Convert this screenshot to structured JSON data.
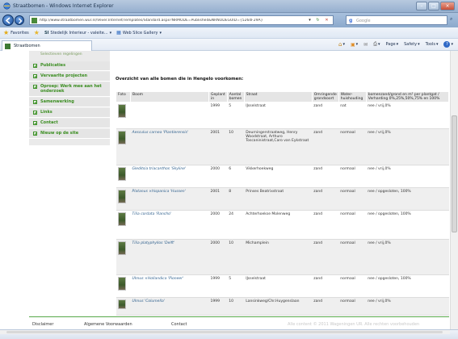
{
  "window": {
    "title": "Straatbomen - Windows Internet Explorer"
  },
  "address_bar": {
    "url": "http://www.straatbomen.wur.nl/Vever.Internet/Templates/Standard.aspx?NRMODE=Published&NRNODEGUID={5264F29A}",
    "search_placeholder": "Google"
  },
  "favorites_bar": {
    "favorites_label": "Favorites",
    "items": [
      {
        "label": "Stedelijk Interieur - valeite..."
      },
      {
        "label": "Web Slice Gallery"
      }
    ]
  },
  "tab": {
    "label": "Straatbomen"
  },
  "command_bar": {
    "items": [
      "Page",
      "Safety",
      "Tools"
    ]
  },
  "leftnav": {
    "cut_text": "Selectieven regelingen",
    "items": [
      {
        "label": "Publicaties"
      },
      {
        "label": "Vervaarlte projecten"
      },
      {
        "label": "Oproep: Werk mee aan het onderzoek"
      },
      {
        "label": "Samenwerking"
      },
      {
        "label": "Links"
      },
      {
        "label": "Contact"
      },
      {
        "label": "Nieuw op de site"
      }
    ]
  },
  "main": {
    "heading": "Overzicht van alle bomen die in Hengelo voorkomen:",
    "columns": [
      "Foto",
      "Boom",
      "Geplant in",
      "Aantal bomen",
      "Straat",
      "Omringende grondsoort",
      "Water-huishouding",
      "bomenzand/grond en m² per plantgat / Verharding 0%,25%,50%,75% en 100%"
    ],
    "rows": [
      {
        "boom": "",
        "geplant": "1999",
        "aantal": "5",
        "straat": "IJsselstraat",
        "grond": "zand",
        "water": "nat",
        "verharding": "nee / vrij,0%"
      },
      {
        "boom": "Aesculus carnea 'Plantierensis'",
        "geplant": "2001",
        "aantal": "10",
        "straat": "Deurningerstraatweg, Henry Woodstraat, Arthuro Toscaninistraat,Caro van Eykstraat",
        "grond": "zand",
        "water": "normaal",
        "verharding": "nee / vrij,0%"
      },
      {
        "boom": "Gleditsia triacanthos 'Skyline'",
        "geplant": "2000",
        "aantal": "6",
        "straat": "Vikkerhoekweg",
        "grond": "zand",
        "water": "normaal",
        "verharding": "nee / vrij,0%"
      },
      {
        "boom": "Platanus ×hispanica 'Hussen'",
        "geplant": "2001",
        "aantal": "8",
        "straat": "Prinses Beatrixstraat",
        "grond": "zand",
        "water": "normaal",
        "verharding": "nee / opgesloten, 100%"
      },
      {
        "boom": "Tilia cordata 'Rancho'",
        "geplant": "2000",
        "aantal": "24",
        "straat": "Achterhoekse Molenweg",
        "grond": "zand",
        "water": "normaal",
        "verharding": "nee / opgesloten, 100%"
      },
      {
        "boom": "Tilia platyphyllos 'Delft'",
        "geplant": "2000",
        "aantal": "10",
        "straat": "Michamplein",
        "grond": "zand",
        "water": "normaal",
        "verharding": "nee / vrij,0%"
      },
      {
        "boom": "Ulmus ×Hollandica 'Pioneer'",
        "geplant": "1999",
        "aantal": "5",
        "straat": "IJsselstraat",
        "grond": "zand",
        "water": "normaal",
        "verharding": "nee / opgesloten, 100%"
      },
      {
        "boom": "Ulmus 'Columella'",
        "geplant": "1999",
        "aantal": "10",
        "straat": "Lansinkweg/Chr.Huygenslaan",
        "grond": "zand",
        "water": "normaal",
        "verharding": "nee / vrij,0%"
      }
    ]
  },
  "footer": {
    "disclaimer": "Disclaimer",
    "voorwaarden": "Algemene Voorwaarden",
    "contact": "Contact",
    "copyright": "Alle content © 2011 Wageningen UR. Alle rechten voorbehouden"
  },
  "colors": {
    "nav_green": "#3a8d20",
    "footer_line": "#58a94a",
    "link": "#2c5e8c"
  }
}
